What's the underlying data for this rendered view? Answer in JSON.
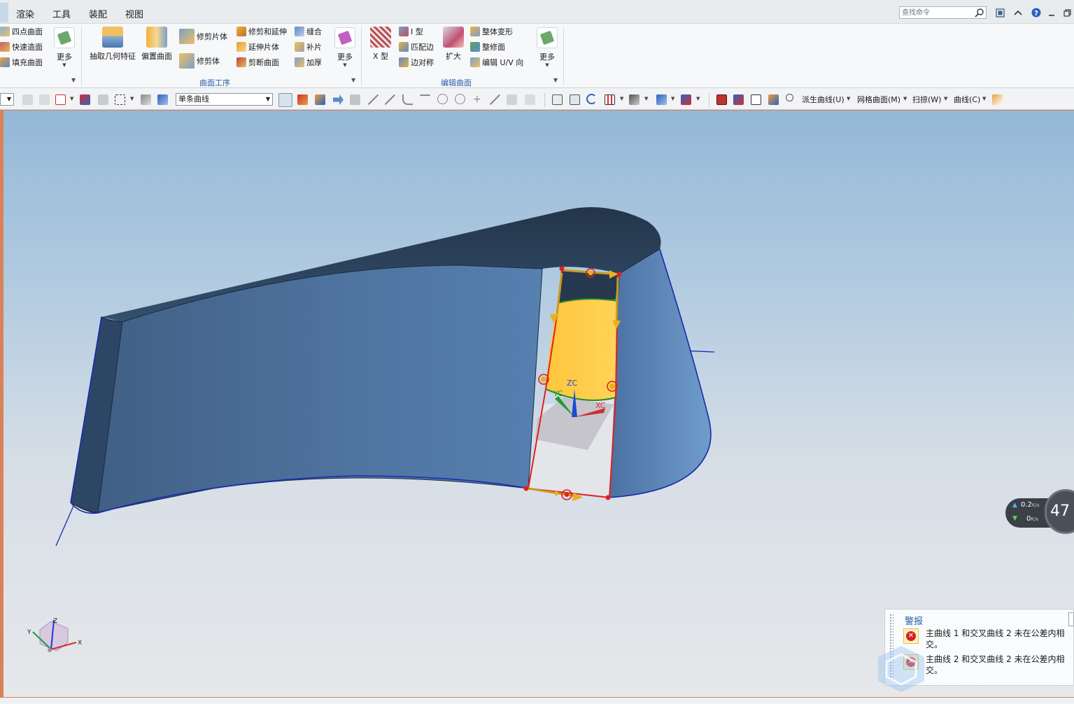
{
  "menu": {
    "items": [
      "渲染",
      "工具",
      "装配",
      "视图"
    ],
    "search_placeholder": "查找命令"
  },
  "ribbon": {
    "group1": {
      "items": [
        "四点曲面",
        "快速造面",
        "填充曲面"
      ],
      "more_label": "更多"
    },
    "group2": {
      "extract_label": "抽取几何特征",
      "offset_label": "偏置曲面",
      "trim_sheet_label": "修剪片体",
      "trim_body_label": "修剪体",
      "col3": [
        "修剪和延伸",
        "延伸片体",
        "剪断曲面"
      ],
      "col4": [
        "缝合",
        "补片",
        "加厚"
      ],
      "more_label": "更多",
      "group_label": "曲面工序"
    },
    "group3": {
      "x_type_label": "X 型",
      "col2": [
        "I 型",
        "匹配边",
        "边对称"
      ],
      "expand_label": "扩大",
      "col4": [
        "整体变形",
        "整修面",
        "编辑 U/V 向"
      ],
      "more_label": "更多",
      "group_label": "编辑曲面"
    }
  },
  "toolbar": {
    "curve_filter_value": "单条曲线",
    "menus": [
      "派生曲线(U)",
      "网格曲面(M)",
      "扫掠(W)",
      "曲线(C)"
    ]
  },
  "viewport": {
    "label_zc": "ZC",
    "label_yc": "YC",
    "label_xc": "XC",
    "triad_x": "X",
    "triad_y": "Y",
    "triad_z": "Z"
  },
  "net_widget": {
    "up_value": "0.2",
    "up_unit": "K/s",
    "down_value": "0",
    "down_unit": "K/s",
    "dial_value": "47"
  },
  "alert": {
    "title": "警报",
    "messages": [
      "主曲线 1 和交叉曲线 2 未在公差内相交。",
      "主曲线 2 和交叉曲线 2 未在公差内相交。"
    ]
  },
  "colors": {
    "accent_blue": "#2a62a8",
    "surface_dark": "#2c3e55",
    "surface_mid": "#4a6a90",
    "highlight_yellow": "#ffcc33",
    "selection_red": "#e02020",
    "viewport_border": "#d9825a",
    "error_red": "#d8202a"
  }
}
